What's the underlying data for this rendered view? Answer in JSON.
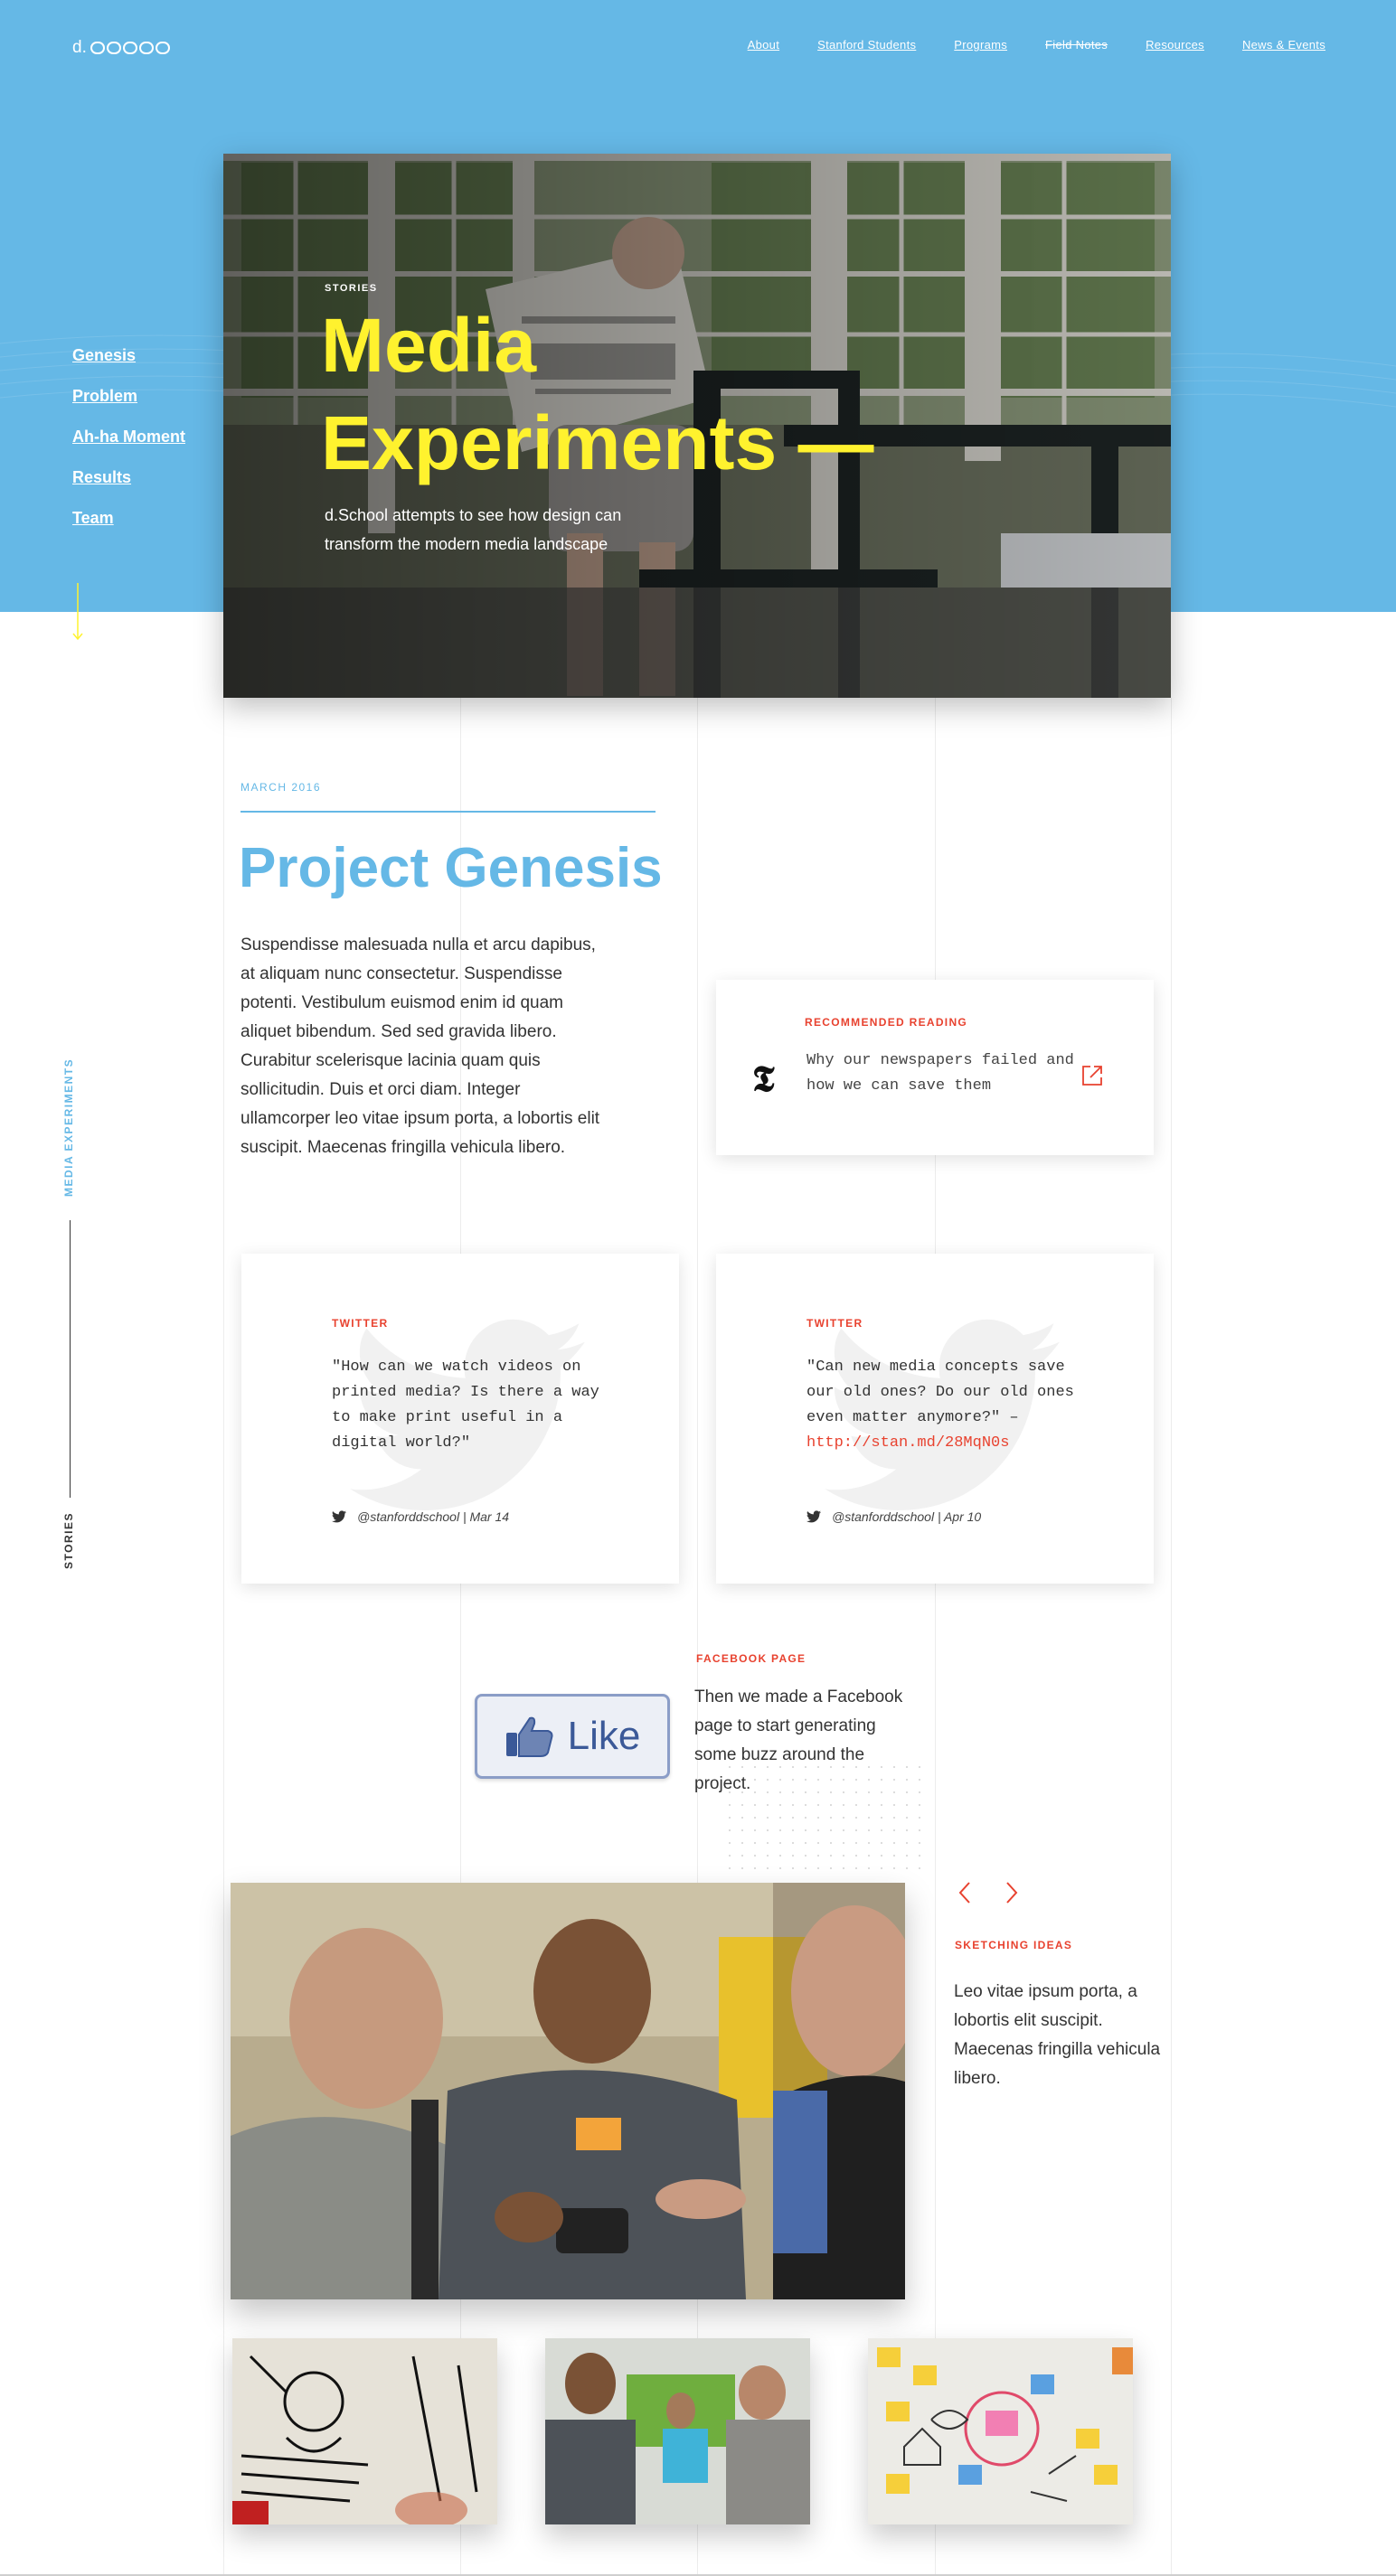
{
  "header": {
    "logo_text": "d.",
    "nav": [
      "About",
      "Stanford Students",
      "Programs",
      "Field Notes",
      "Resources",
      "News & Events"
    ]
  },
  "side_nav": [
    "Genesis",
    "Problem",
    "Ah-ha Moment",
    "Results",
    "Team"
  ],
  "hero": {
    "label": "STORIES",
    "title": "Media Experiments —",
    "subtitle": "d.School attempts to see how design can transform the modern media landscape",
    "image": "man-reading-newspaper-by-window"
  },
  "vertical": {
    "section": "MEDIA EXPERIMENTS",
    "category": "STORIES"
  },
  "article": {
    "date": "MARCH 2016",
    "title": "Project Genesis",
    "body": "Suspendisse malesuada nulla et arcu dapibus, at aliquam nunc consectetur. Suspendisse potenti. Vestibulum euismod enim id quam aliquet bibendum. Sed sed gravida libero. Curabitur scelerisque lacinia quam quis sollicitudin. Duis et orci diam. Integer ullamcorper leo vitae ipsum porta, a lobortis elit suscipit. Maecenas fringilla vehicula libero."
  },
  "reading": {
    "label": "RECOMMENDED READING",
    "logo": "𝕿",
    "text": "Why our newspapers failed and how we can save them"
  },
  "tweets": [
    {
      "label": "TWITTER",
      "text": "\"How can we watch videos on printed media? Is there a way to make print useful in a digital world?\"",
      "link": "",
      "handle": "@stanforddschool",
      "date": "Mar 14"
    },
    {
      "label": "TWITTER",
      "text": "\"Can new media concepts save our old ones? Do our old ones even matter anymore?\" –",
      "link": "http://stan.md/28MqN0s",
      "handle": "@stanforddschool",
      "date": "Apr 10"
    }
  ],
  "facebook": {
    "like_label": "Like",
    "label": "FACEBOOK PAGE",
    "text": "Then we made a Facebook page to start generating some buzz around the project."
  },
  "sketching": {
    "label": "SKETCHING IDEAS",
    "text": "Leo vitae ipsum porta, a lobortis elit suscipit. Maecenas fringilla vehicula libero."
  },
  "images": {
    "main_photo": "students-looking-at-phone",
    "thumbnails": [
      "sketch-drawing-on-glass",
      "students-talking-in-hallway",
      "whiteboard-with-sticky-notes"
    ]
  },
  "colors": {
    "hero_blue": "#65b8e6",
    "title_yellow": "#fff22e",
    "accent_red": "#e8422f"
  }
}
